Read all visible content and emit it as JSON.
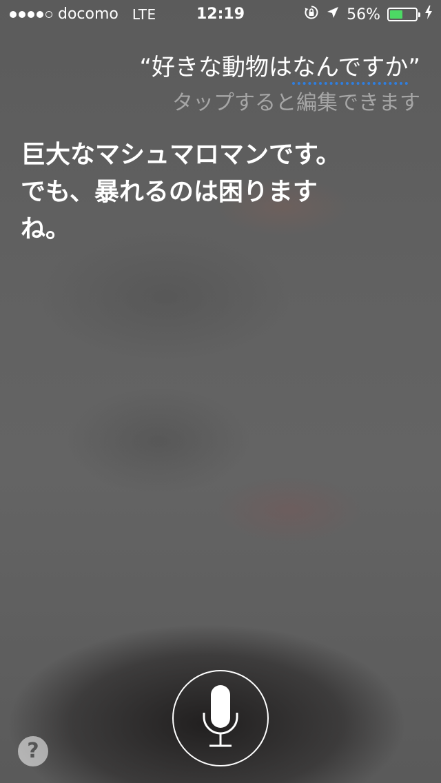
{
  "status_bar": {
    "carrier": "docomo",
    "network": "LTE",
    "time": "12:19",
    "battery_percent": "56%",
    "signal_bars_filled": 4,
    "signal_bars_total": 5,
    "battery_level": 0.56,
    "battery_color": "#4cd964",
    "icons": [
      "rotation-lock-icon",
      "location-arrow-icon",
      "battery-icon",
      "charging-bolt-icon"
    ]
  },
  "siri": {
    "query_prefix": "“好きな動物は",
    "query_uncertain": "なんですか",
    "query_suffix": "”",
    "tap_to_edit": "タップすると編集できます",
    "response_lines": [
      "巨大なマシュマロマンです。",
      "でも、暴れるのは困ります",
      "ね。"
    ],
    "uncertain_underline_color": "#2f7fe0"
  },
  "controls": {
    "mic_icon": "microphone-icon",
    "help_label": "?"
  }
}
